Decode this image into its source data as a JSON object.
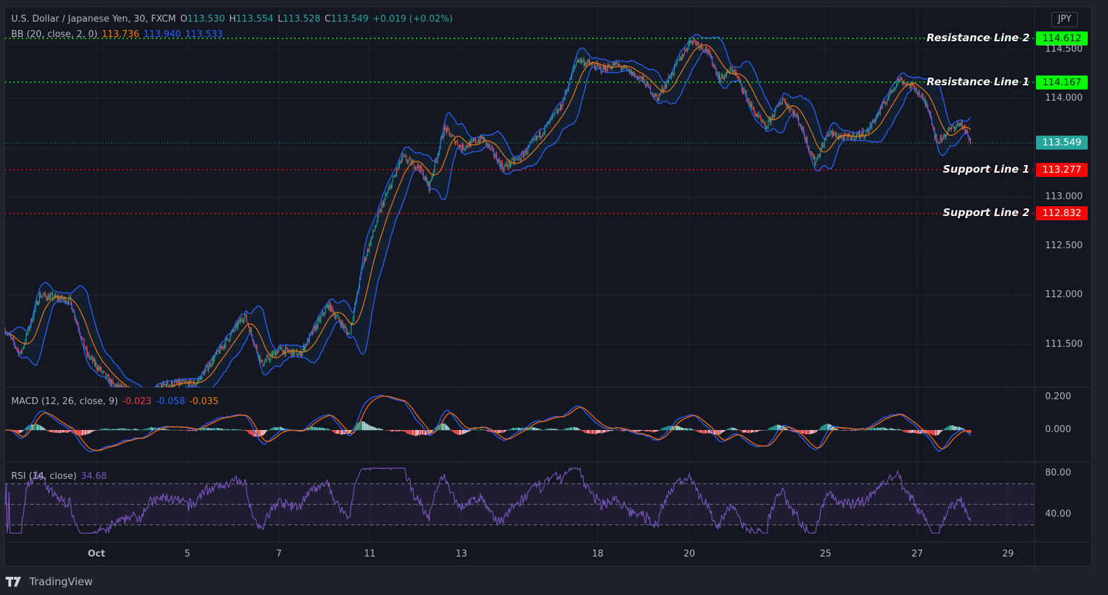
{
  "header": {
    "symbol": "U.S. Dollar / Japanese Yen, 30, FXCM",
    "o_label": "O",
    "o": "113.530",
    "h_label": "H",
    "h": "113.554",
    "l_label": "L",
    "l": "113.528",
    "c_label": "C",
    "c": "113.549",
    "change": "+0.019 (+0.02%)"
  },
  "bb": {
    "label": "BB (20, close, 2, 0)",
    "basis": "113.736",
    "upper": "113.940",
    "lower": "113.533"
  },
  "macd": {
    "label": "MACD (12, 26, close, 9)",
    "hist": "-0.023",
    "macd": "-0.058",
    "signal": "-0.035"
  },
  "rsi": {
    "label": "RSI (14, close)",
    "value": "34.68"
  },
  "currency": "JPY",
  "brand": "TradingView",
  "colors": {
    "up": "#26a69a",
    "down": "#ef5350",
    "bb_basis": "#f57c00",
    "bb_band": "#2962ff",
    "macd": "#2962ff",
    "signal": "#ff6d00",
    "rsi": "#7e57c2",
    "resistance": "#00ff00",
    "support": "#ff0000"
  },
  "chart_data": {
    "type": "candlestick",
    "timeframe": "30",
    "price_ticks": [
      "114.500",
      "114.000",
      "113.500",
      "113.000",
      "112.500",
      "112.000",
      "111.500"
    ],
    "macd_ticks": [
      "0.200",
      "0.000"
    ],
    "rsi_ticks": [
      "80.00",
      "40.00"
    ],
    "rsi_bands": [
      70,
      50,
      30
    ],
    "time_ticks": [
      "Oct",
      "5",
      "7",
      "11",
      "13",
      "18",
      "20",
      "25",
      "27",
      "29"
    ],
    "trading_days": [
      "Sep 29",
      "Sep 30",
      "Oct 1",
      "Oct 4",
      "Oct 5",
      "Oct 6",
      "Oct 7",
      "Oct 8",
      "Oct 11",
      "Oct 12",
      "Oct 13",
      "Oct 14",
      "Oct 15",
      "Oct 18",
      "Oct 19",
      "Oct 20",
      "Oct 21",
      "Oct 22",
      "Oct 25",
      "Oct 26",
      "Oct 27",
      "Oct 28",
      "Oct 29"
    ],
    "last_price": "113.549",
    "levels": [
      {
        "label": "Resistance Line 2",
        "value": "114.612",
        "kind": "resistance"
      },
      {
        "label": "Resistance Line 1",
        "value": "114.167",
        "kind": "resistance"
      },
      {
        "label": "Support Line 1",
        "value": "113.277",
        "kind": "support"
      },
      {
        "label": "Support Line 2",
        "value": "112.832",
        "kind": "support"
      }
    ],
    "close_path": [
      [
        "Sep 29 00:00",
        111.65
      ],
      [
        "Sep 29 08:00",
        111.4
      ],
      [
        "Sep 29 18:00",
        112.0
      ],
      [
        "Sep 30 10:00",
        111.95
      ],
      [
        "Sep 30 19:00",
        111.4
      ],
      [
        "Oct 1 08:00",
        111.1
      ],
      [
        "Oct 1 23:00",
        110.95
      ],
      [
        "Oct 4 13:00",
        111.1
      ],
      [
        "Oct 5 04:00",
        111.1
      ],
      [
        "Oct 5 19:00",
        111.5
      ],
      [
        "Oct 6 06:00",
        111.8
      ],
      [
        "Oct 6 15:00",
        111.3
      ],
      [
        "Oct 7 00:00",
        111.45
      ],
      [
        "Oct 7 11:00",
        111.4
      ],
      [
        "Oct 8 02:00",
        111.9
      ],
      [
        "Oct 8 13:00",
        111.6
      ],
      [
        "Oct 8 20:00",
        112.3
      ],
      [
        "Oct 11 06:00",
        112.9
      ],
      [
        "Oct 11 17:00",
        113.4
      ],
      [
        "Oct 12 02:00",
        113.3
      ],
      [
        "Oct 12 07:00",
        113.1
      ],
      [
        "Oct 12 15:00",
        113.7
      ],
      [
        "Oct 13 00:00",
        113.5
      ],
      [
        "Oct 13 11:00",
        113.6
      ],
      [
        "Oct 13 22:00",
        113.3
      ],
      [
        "Oct 14 07:00",
        113.4
      ],
      [
        "Oct 14 18:00",
        113.65
      ],
      [
        "Oct 15 04:00",
        113.9
      ],
      [
        "Oct 15 13:00",
        114.4
      ],
      [
        "Oct 18 02:00",
        114.3
      ],
      [
        "Oct 18 09:00",
        114.35
      ],
      [
        "Oct 18 23:00",
        114.2
      ],
      [
        "Oct 19 07:00",
        114.0
      ],
      [
        "Oct 19 16:00",
        114.3
      ],
      [
        "Oct 20 01:00",
        114.6
      ],
      [
        "Oct 20 09:00",
        114.5
      ],
      [
        "Oct 20 16:00",
        114.2
      ],
      [
        "Oct 20 23:00",
        114.3
      ],
      [
        "Oct 21 09:00",
        113.9
      ],
      [
        "Oct 21 16:00",
        113.7
      ],
      [
        "Oct 22 01:00",
        114.0
      ],
      [
        "Oct 22 09:00",
        113.8
      ],
      [
        "Oct 22 18:00",
        113.35
      ],
      [
        "Oct 25 01:00",
        113.65
      ],
      [
        "Oct 25 10:00",
        113.6
      ],
      [
        "Oct 25 21:00",
        113.65
      ],
      [
        "Oct 26 05:00",
        113.9
      ],
      [
        "Oct 26 14:00",
        114.2
      ],
      [
        "Oct 26 23:00",
        114.1
      ],
      [
        "Oct 27 06:00",
        113.9
      ],
      [
        "Oct 27 10:00",
        113.55
      ],
      [
        "Oct 27 18:00",
        113.7
      ],
      [
        "Oct 27 23:00",
        113.75
      ],
      [
        "Oct 28 04:00",
        113.549
      ]
    ]
  }
}
